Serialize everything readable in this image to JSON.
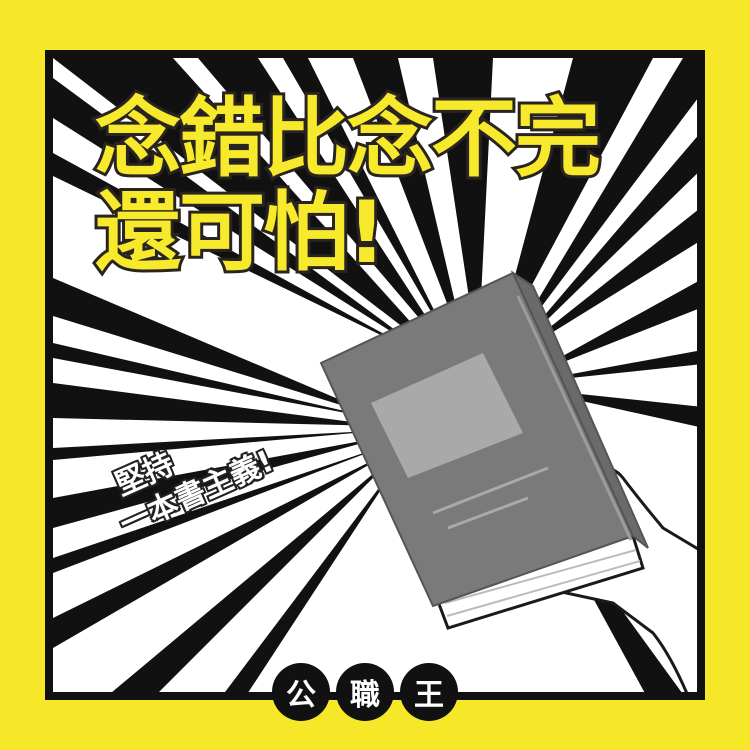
{
  "headline": {
    "line1": "念錯比念不完",
    "line2": "還可怕!"
  },
  "tagline": {
    "line1": "堅持",
    "line2": "一本書主義!"
  },
  "brand": {
    "chars": [
      "公",
      "職",
      "王"
    ]
  },
  "colors": {
    "background": "#f6e729",
    "ink": "#111111",
    "book": "#7a7a7a",
    "hand": "#ffffff"
  },
  "icons": [
    "book-icon",
    "hand-icon"
  ]
}
